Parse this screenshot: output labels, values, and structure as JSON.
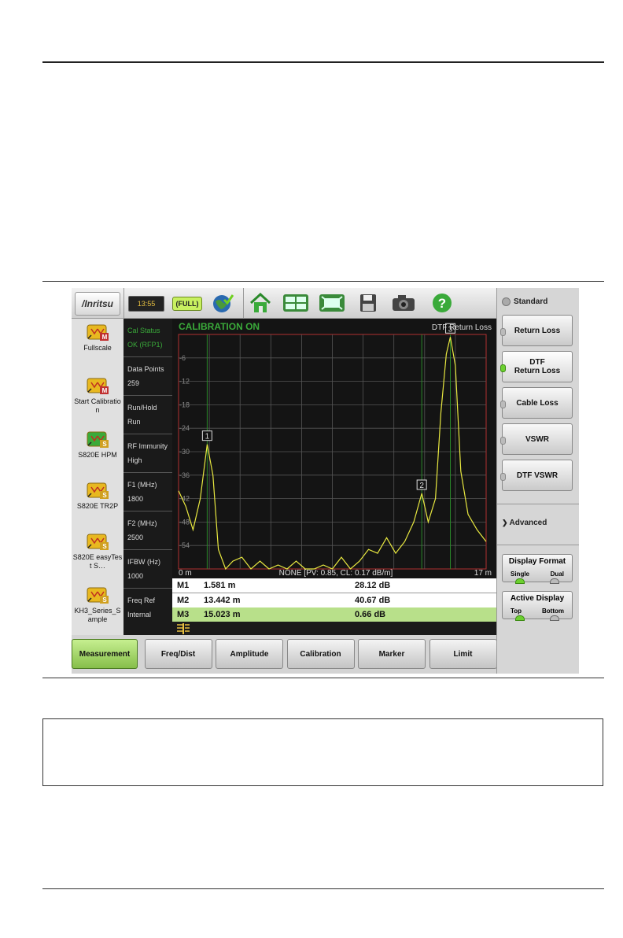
{
  "topbar": {
    "logo": "/Inritsu",
    "time": "13:55",
    "battery": "(FULL)",
    "icons": [
      "globe-icon",
      "home-icon",
      "layout-icon",
      "fullscreen-icon",
      "save-icon",
      "camera-icon",
      "help-icon"
    ]
  },
  "sidebar": {
    "items": [
      {
        "label": "Fullscale",
        "icon": "fullscale-app-icon",
        "badge": "M"
      },
      {
        "label": "Start Calibration",
        "icon": "calibration-app-icon",
        "badge": "M"
      },
      {
        "label": "S820E HPM",
        "icon": "hpm-app-icon",
        "badge": "S"
      },
      {
        "label": "S820E TR2P",
        "icon": "tr2p-app-icon",
        "badge": "S"
      },
      {
        "label": "S820E easyTest S…",
        "icon": "easytest-app-icon",
        "badge": "S"
      },
      {
        "label": "KH3_Series_Sample",
        "icon": "kh3-app-icon",
        "badge": "S"
      }
    ]
  },
  "settings": [
    {
      "label": "Cal Status",
      "value": "OK (RFP1)"
    },
    {
      "label": "Data Points",
      "value": "259"
    },
    {
      "label": "Run/Hold",
      "value": "Run"
    },
    {
      "label": "RF Immunity",
      "value": "High"
    },
    {
      "label": "F1 (MHz)",
      "value": "1800"
    },
    {
      "label": "F2 (MHz)",
      "value": "2500"
    },
    {
      "label": "IFBW (Hz)",
      "value": "1000"
    },
    {
      "label": "Freq Ref",
      "value": "Internal"
    }
  ],
  "graph": {
    "status": "CALIBRATION ON",
    "title": "DTF Return Loss",
    "x_start": "0 m",
    "x_end": "17 m",
    "footer": "NONE [PV: 0.85,  CL: 0.17 dB/m]",
    "y_ticks": [
      "-6",
      "-12",
      "-18",
      "-24",
      "-30",
      "-36",
      "-42",
      "-48",
      "-54"
    ],
    "trace_color": "#e8e840",
    "status_color": "#3aaa3a"
  },
  "chart_data": {
    "type": "line",
    "xlabel": "",
    "ylabel": "",
    "xlim": [
      0,
      17
    ],
    "ylim": [
      -60,
      0
    ],
    "series": [
      {
        "x": [
          0,
          0.4,
          0.8,
          1.2,
          1.581,
          1.9,
          2.2,
          2.6,
          3.0,
          3.5,
          4.0,
          4.5,
          5.0,
          5.5,
          6.0,
          6.5,
          7.0,
          7.5,
          8.0,
          8.5,
          9.0,
          9.5,
          10.0,
          10.5,
          11.0,
          11.5,
          12.0,
          12.5,
          13.0,
          13.442,
          13.8,
          14.2,
          14.5,
          14.8,
          15.023,
          15.3,
          15.6,
          16.0,
          16.5,
          17.0
        ],
        "y": [
          -40,
          -44,
          -50,
          -42,
          -28.12,
          -36,
          -55,
          -60,
          -58,
          -57,
          -60,
          -58,
          -60,
          -59,
          -60,
          -58,
          -60,
          -60,
          -59,
          -60,
          -57,
          -60,
          -58,
          -55,
          -56,
          -52,
          -56,
          -53,
          -48,
          -40.67,
          -48,
          -42,
          -20,
          -5,
          -0.66,
          -8,
          -35,
          -46,
          -50,
          -53
        ]
      }
    ],
    "markers": [
      {
        "id": "1",
        "x": 1.581,
        "y": -28.12
      },
      {
        "id": "2",
        "x": 13.442,
        "y": -40.67
      },
      {
        "id": "3",
        "x": 15.023,
        "y": -0.66
      }
    ]
  },
  "markers_table": [
    {
      "name": "M1",
      "pos": "1.581 m",
      "val": "28.12 dB"
    },
    {
      "name": "M2",
      "pos": "13.442 m",
      "val": "40.67 dB"
    },
    {
      "name": "M3",
      "pos": "15.023 m",
      "val": "0.66 dB"
    }
  ],
  "tabs": [
    "Measurement",
    "Freq/Dist",
    "Amplitude",
    "Calibration",
    "Marker",
    "Limit"
  ],
  "right": {
    "standard": "Standard",
    "buttons": [
      {
        "label": "Return Loss",
        "label2": ""
      },
      {
        "label": "DTF",
        "label2": "Return Loss"
      },
      {
        "label": "Cable Loss",
        "label2": ""
      },
      {
        "label": "VSWR",
        "label2": ""
      },
      {
        "label": "DTF VSWR",
        "label2": ""
      }
    ],
    "advanced": "Advanced",
    "display_format": {
      "title": "Display Format",
      "opt1": "Single",
      "opt2": "Dual"
    },
    "active_display": {
      "title": "Active Display",
      "opt1": "Top",
      "opt2": "Bottom"
    }
  }
}
